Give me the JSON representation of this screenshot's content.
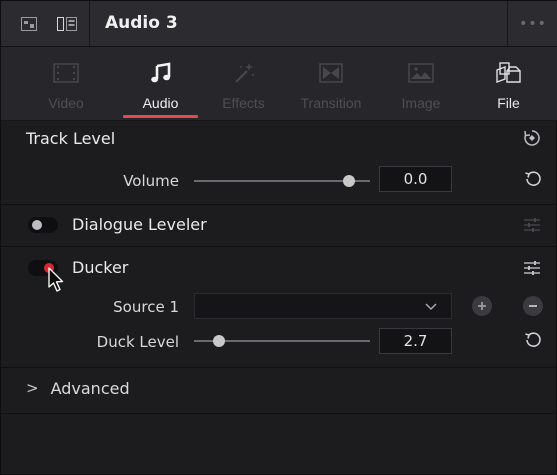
{
  "header": {
    "title": "Audio 3",
    "menu_glyph": "•••"
  },
  "tabs": [
    {
      "label": "Video",
      "icon": "video-film-icon",
      "state": "disabled"
    },
    {
      "label": "Audio",
      "icon": "music-note-icon",
      "state": "active"
    },
    {
      "label": "Effects",
      "icon": "magic-wand-icon",
      "state": "disabled"
    },
    {
      "label": "Transition",
      "icon": "transition-icon",
      "state": "disabled"
    },
    {
      "label": "Image",
      "icon": "image-icon",
      "state": "disabled"
    },
    {
      "label": "File",
      "icon": "file-icon",
      "state": "enabled"
    }
  ],
  "track_level": {
    "title": "Track Level",
    "volume_label": "Volume",
    "volume_value": "0.0",
    "volume_fraction": 0.88
  },
  "dialogue_leveler": {
    "label": "Dialogue Leveler",
    "enabled": false
  },
  "ducker": {
    "label": "Ducker",
    "enabled": true,
    "source_label": "Source 1",
    "source_value": "",
    "duck_level_label": "Duck Level",
    "duck_level_value": "2.7",
    "duck_level_fraction": 0.14
  },
  "advanced": {
    "label": "Advanced",
    "chevron": ">"
  },
  "colors": {
    "accent_red": "#e6484f",
    "toggle_on": "#d9262c",
    "background": "#1c1c1f"
  }
}
